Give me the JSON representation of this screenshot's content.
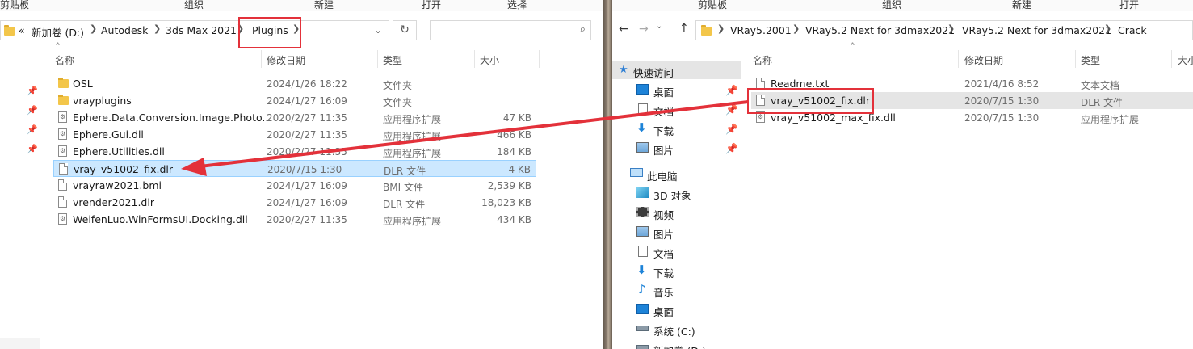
{
  "left": {
    "ribbon": [
      "剪贴板",
      "组织",
      "新建",
      "打开",
      "选择"
    ],
    "address": {
      "overflow": "«",
      "crumbs": [
        "新加卷 (D:)",
        "Autodesk",
        "3ds Max 2021",
        "Plugins"
      ]
    },
    "columns": {
      "name": "名称",
      "date": "修改日期",
      "type": "类型",
      "size": "大小"
    },
    "files": [
      {
        "name": "OSL",
        "date": "2024/1/26 18:22",
        "type": "文件夹",
        "size": "",
        "icon": "folder-icon"
      },
      {
        "name": "vrayplugins",
        "date": "2024/1/27 16:09",
        "type": "文件夹",
        "size": "",
        "icon": "folder-icon"
      },
      {
        "name": "Ephere.Data.Conversion.Image.Photo...",
        "date": "2020/2/27 11:35",
        "type": "应用程序扩展",
        "size": "47 KB",
        "icon": "dll-icon"
      },
      {
        "name": "Ephere.Gui.dll",
        "date": "2020/2/27 11:35",
        "type": "应用程序扩展",
        "size": "466 KB",
        "icon": "dll-icon"
      },
      {
        "name": "Ephere.Utilities.dll",
        "date": "2020/2/27 11:35",
        "type": "应用程序扩展",
        "size": "184 KB",
        "icon": "dll-icon"
      },
      {
        "name": "vray_v51002_fix.dlr",
        "date": "2020/7/15 1:30",
        "type": "DLR 文件",
        "size": "4 KB",
        "icon": "file-icon"
      },
      {
        "name": "vrayraw2021.bmi",
        "date": "2024/1/27 16:09",
        "type": "BMI 文件",
        "size": "2,539 KB",
        "icon": "file-icon"
      },
      {
        "name": "vrender2021.dlr",
        "date": "2024/1/27 16:09",
        "type": "DLR 文件",
        "size": "18,023 KB",
        "icon": "file-icon"
      },
      {
        "name": "WeifenLuo.WinFormsUI.Docking.dll",
        "date": "2020/2/27 11:35",
        "type": "应用程序扩展",
        "size": "434 KB",
        "icon": "dll-icon"
      }
    ]
  },
  "right": {
    "ribbon": [
      "剪贴板",
      "组织",
      "新建",
      "打开"
    ],
    "address": {
      "crumbs": [
        "VRay5.2001",
        "VRay5.2 Next for 3dmax2021",
        "VRay5.2 Next for 3dmax2021",
        "Crack"
      ]
    },
    "columns": {
      "name": "名称",
      "date": "修改日期",
      "type": "类型",
      "size": "大小"
    },
    "nav": [
      {
        "label": "快速访问",
        "icon": "star-icon"
      },
      {
        "label": "桌面",
        "icon": "desktop-icon"
      },
      {
        "label": "文档",
        "icon": "document-icon"
      },
      {
        "label": "下载",
        "icon": "download-icon"
      },
      {
        "label": "图片",
        "icon": "picture-icon"
      },
      {
        "label": "此电脑",
        "icon": "computer-icon"
      },
      {
        "label": "3D 对象",
        "icon": "cube-icon"
      },
      {
        "label": "视频",
        "icon": "video-icon"
      },
      {
        "label": "图片",
        "icon": "picture-icon"
      },
      {
        "label": "文档",
        "icon": "document-icon"
      },
      {
        "label": "下载",
        "icon": "download-icon"
      },
      {
        "label": "音乐",
        "icon": "music-icon"
      },
      {
        "label": "桌面",
        "icon": "desktop-icon"
      },
      {
        "label": "系统 (C:)",
        "icon": "drive-icon"
      },
      {
        "label": "新加卷 (D:)",
        "icon": "drive-icon"
      }
    ],
    "files": [
      {
        "name": "Readme.txt",
        "date": "2021/4/16 8:52",
        "type": "文本文档",
        "icon": "text-file-icon"
      },
      {
        "name": "vray_v51002_fix.dlr",
        "date": "2020/7/15 1:30",
        "type": "DLR 文件",
        "icon": "file-icon"
      },
      {
        "name": "vray_v51002_max_fix.dll",
        "date": "2020/7/15 1:30",
        "type": "应用程序扩展",
        "icon": "dll-icon"
      }
    ]
  },
  "colors": {
    "highlight": "#e3313a",
    "selection": "#cce8ff",
    "folder": "#f3c64a"
  }
}
